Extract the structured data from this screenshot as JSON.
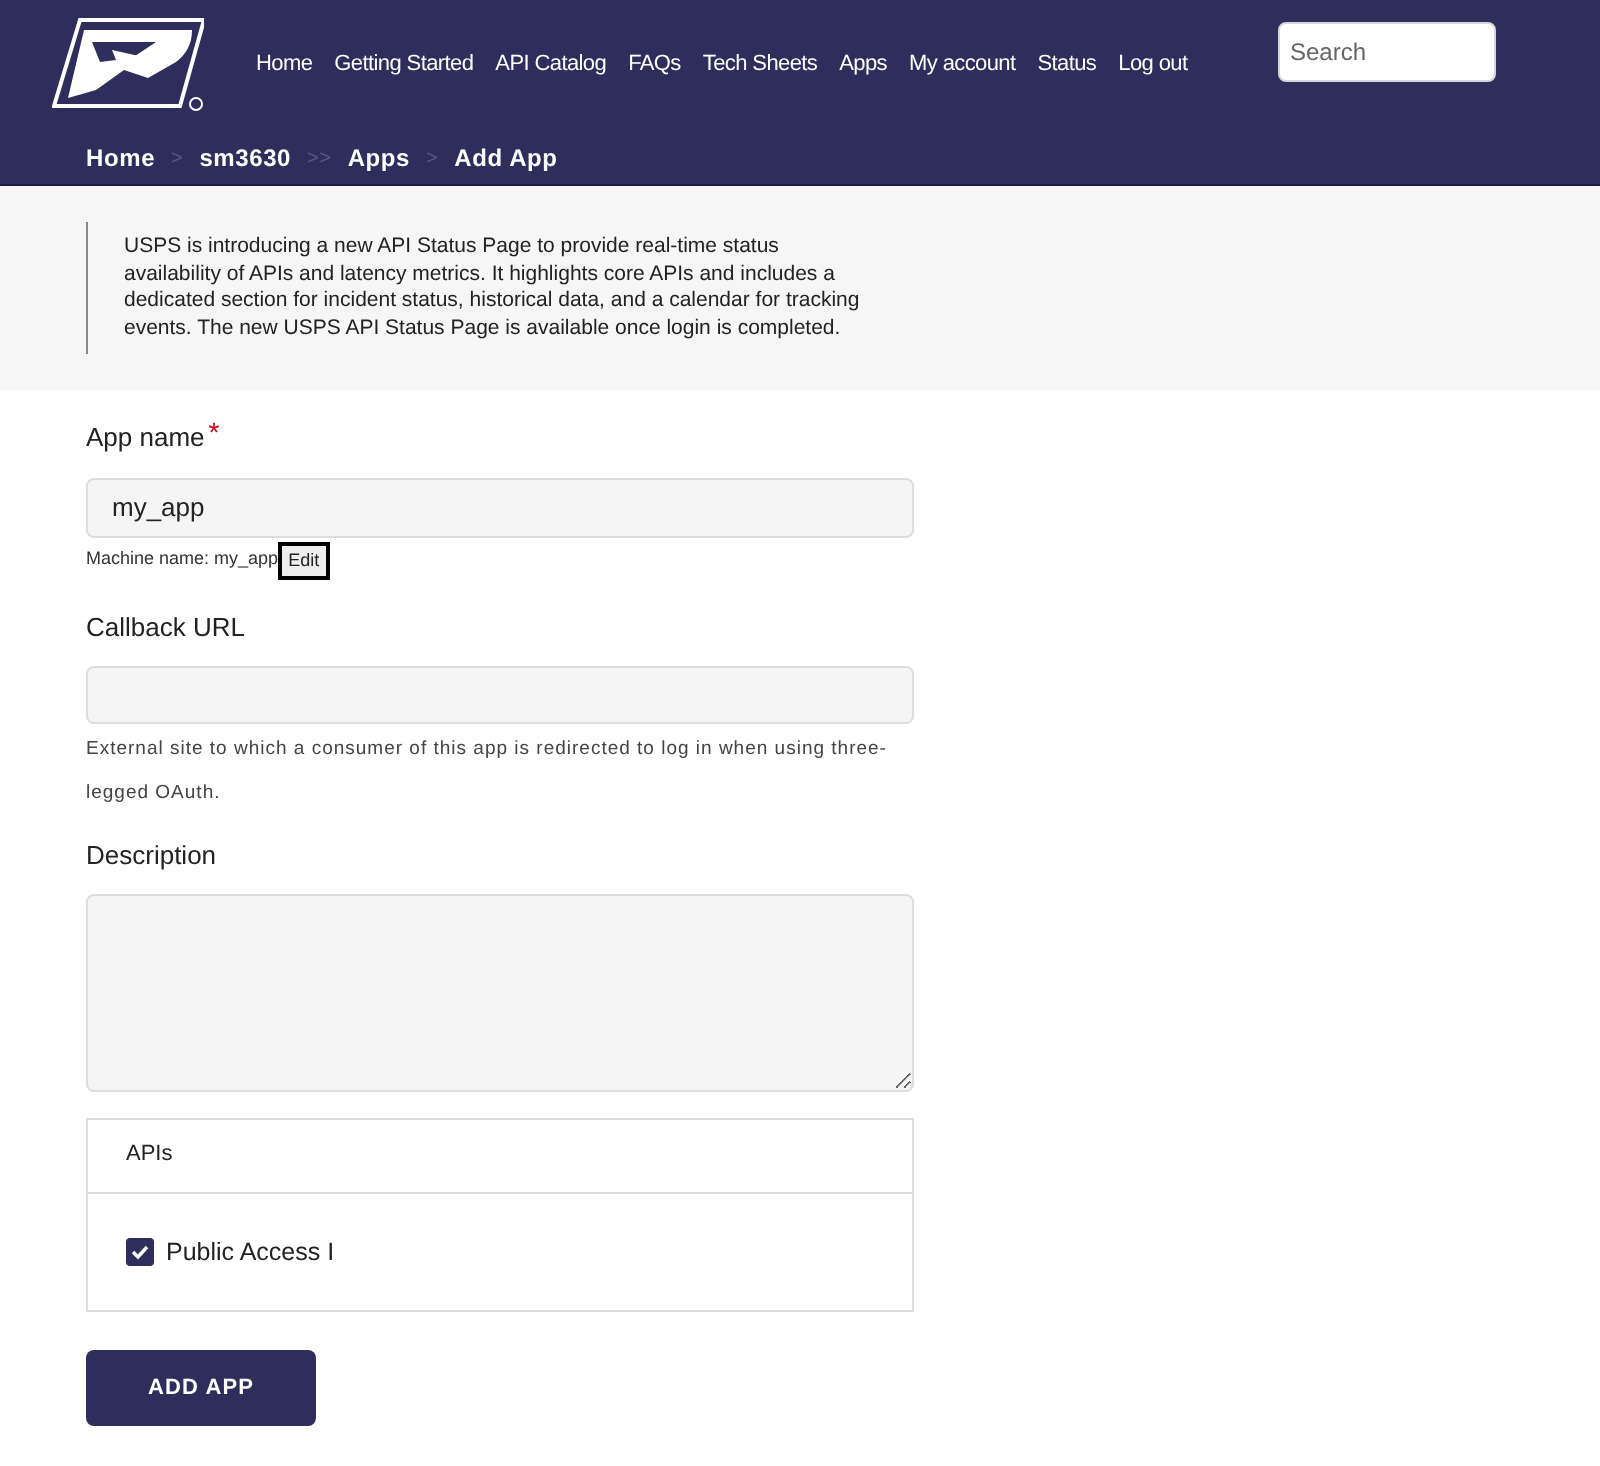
{
  "nav": [
    "Home",
    "Getting Started",
    "API Catalog",
    "FAQs",
    "Tech Sheets",
    "Apps",
    "My account",
    "Status",
    "Log out"
  ],
  "search": {
    "placeholder": "Search"
  },
  "breadcrumb": [
    {
      "label": "Home",
      "separator": ">"
    },
    {
      "label": "sm3630",
      "separator": ">>"
    },
    {
      "label": "Apps",
      "separator": ">"
    },
    {
      "label": "Add App"
    }
  ],
  "notice": "USPS is introducing a new API Status Page to provide real-time status availability of APIs and latency metrics. It highlights core APIs and includes a dedicated section for incident status, historical data, and a calendar for tracking events. The new USPS API Status Page is available once login is completed.",
  "app_name": {
    "label": "App name",
    "required_mark": "*",
    "value": "my_app",
    "machine_name": "Machine name: my_app",
    "edit": "Edit"
  },
  "callback_url": {
    "label": "Callback URL",
    "help": "External site to which a consumer of this app is redirected to log in when using three-legged OAuth."
  },
  "description": {
    "label": "Description"
  },
  "apis": {
    "heading": "APIs",
    "items": [
      {
        "label": "Public Access I",
        "checked": true
      }
    ]
  },
  "submit": "ADD APP"
}
